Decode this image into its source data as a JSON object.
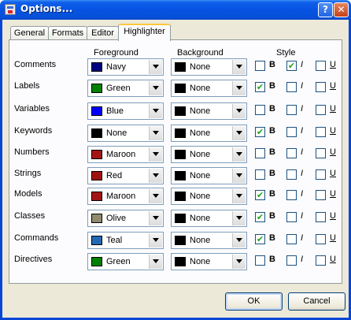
{
  "window": {
    "title": "Options...",
    "help_label": "?",
    "close_label": "✕"
  },
  "tabs": [
    "General",
    "Formats",
    "Editor",
    "Highlighter"
  ],
  "active_tab": "Highlighter",
  "headers": {
    "foreground": "Foreground",
    "background": "Background",
    "style": "Style"
  },
  "style_labels": {
    "bold": "B",
    "italic": "I",
    "underline": "U"
  },
  "rows": [
    {
      "label": "Comments",
      "fg": {
        "name": "Navy",
        "color": "#000080"
      },
      "bg": {
        "name": "None",
        "color": "#000000"
      },
      "bold": false,
      "italic": true,
      "underline": false
    },
    {
      "label": "Labels",
      "fg": {
        "name": "Green",
        "color": "#008000"
      },
      "bg": {
        "name": "None",
        "color": "#000000"
      },
      "bold": true,
      "italic": false,
      "underline": false
    },
    {
      "label": "Variables",
      "fg": {
        "name": "Blue",
        "color": "#0000ff"
      },
      "bg": {
        "name": "None",
        "color": "#000000"
      },
      "bold": false,
      "italic": false,
      "underline": false
    },
    {
      "label": "Keywords",
      "fg": {
        "name": "None",
        "color": "#000000"
      },
      "bg": {
        "name": "None",
        "color": "#000000"
      },
      "bold": true,
      "italic": false,
      "underline": false
    },
    {
      "label": "Numbers",
      "fg": {
        "name": "Maroon",
        "color": "#a31515"
      },
      "bg": {
        "name": "None",
        "color": "#000000"
      },
      "bold": false,
      "italic": false,
      "underline": false
    },
    {
      "label": "Strings",
      "fg": {
        "name": "Red",
        "color": "#a01010"
      },
      "bg": {
        "name": "None",
        "color": "#000000"
      },
      "bold": false,
      "italic": false,
      "underline": false
    },
    {
      "label": "Models",
      "fg": {
        "name": "Maroon",
        "color": "#a31515"
      },
      "bg": {
        "name": "None",
        "color": "#000000"
      },
      "bold": true,
      "italic": false,
      "underline": false
    },
    {
      "label": "Classes",
      "fg": {
        "name": "Olive",
        "color": "#8f8a70"
      },
      "bg": {
        "name": "None",
        "color": "#000000"
      },
      "bold": true,
      "italic": false,
      "underline": false
    },
    {
      "label": "Commands",
      "fg": {
        "name": "Teal",
        "color": "#2468b4"
      },
      "bg": {
        "name": "None",
        "color": "#000000"
      },
      "bold": true,
      "italic": false,
      "underline": false
    },
    {
      "label": "Directives",
      "fg": {
        "name": "Green",
        "color": "#008000"
      },
      "bg": {
        "name": "None",
        "color": "#000000"
      },
      "bold": false,
      "italic": false,
      "underline": false
    }
  ],
  "buttons": {
    "ok": "OK",
    "cancel": "Cancel"
  }
}
